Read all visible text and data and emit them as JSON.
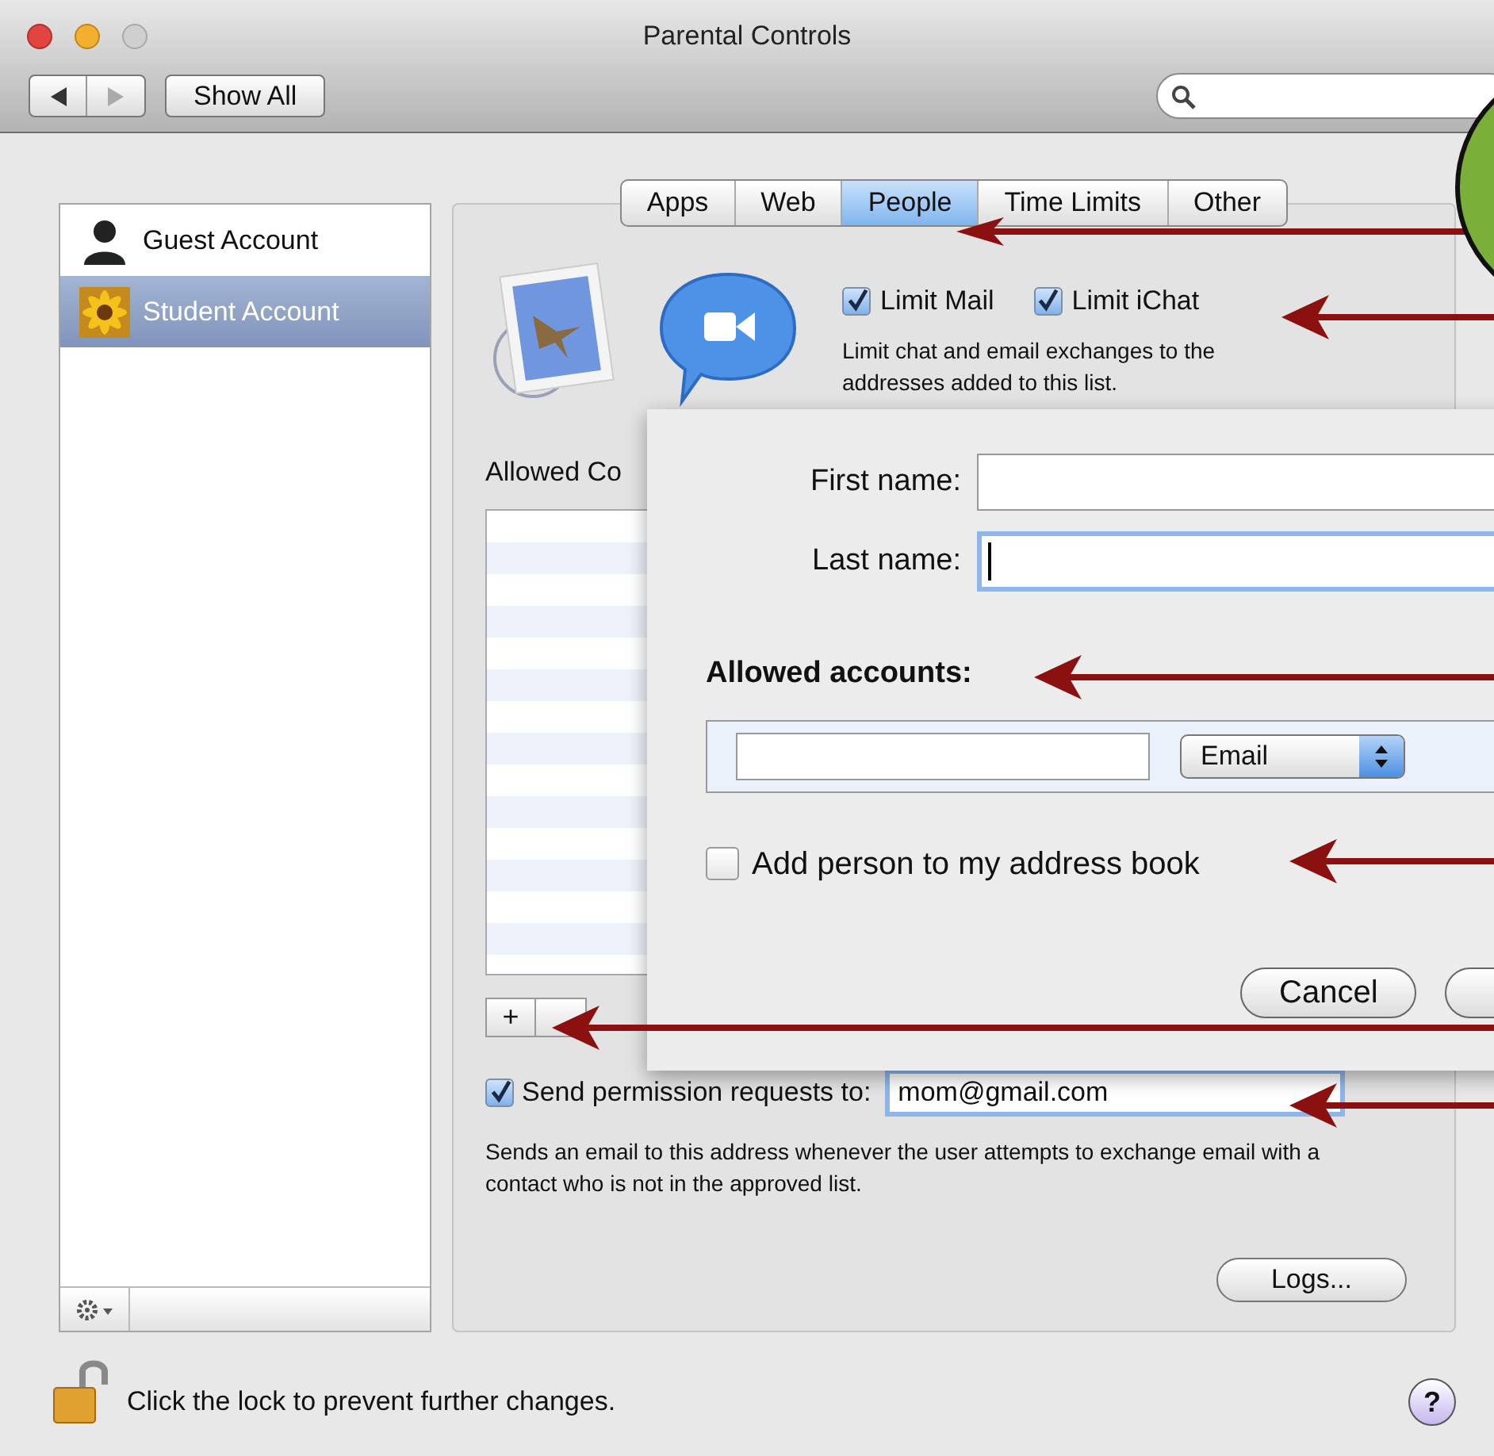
{
  "window": {
    "title": "Parental Controls"
  },
  "toolbar": {
    "show_all": "Show All"
  },
  "accounts": [
    {
      "name": "Guest Account",
      "kind": "guest",
      "selected": false
    },
    {
      "name": "Student Account",
      "kind": "student",
      "selected": true
    }
  ],
  "tabs": [
    {
      "label": "Apps",
      "selected": false
    },
    {
      "label": "Web",
      "selected": false
    },
    {
      "label": "People",
      "selected": true
    },
    {
      "label": "Time Limits",
      "selected": false
    },
    {
      "label": "Other",
      "selected": false
    }
  ],
  "limits": [
    {
      "label": "Limit Mail",
      "checked": true
    },
    {
      "label": "Limit iChat",
      "checked": true
    }
  ],
  "limits_note": "Limit chat and email exchanges to the addresses added to this list.",
  "contacts_label": "Allowed Co",
  "add_button": "+",
  "send_permission": {
    "label": "Send permission requests to:",
    "checked": true,
    "value": "mom@gmail.com"
  },
  "send_note": "Sends an email to this address whenever the user attempts to exchange email with a contact who is not in the approved list.",
  "logs_button": "Logs...",
  "sheet": {
    "first_name_label": "First name:",
    "last_name_label": "Last name:",
    "accounts_label": "Allowed accounts:",
    "account_type": "Email",
    "address_book": {
      "label": "Add person to my address book",
      "checked": false
    },
    "cancel_button": "Cancel"
  },
  "lock_text": "Click the lock to prevent further changes.",
  "help": "?"
}
